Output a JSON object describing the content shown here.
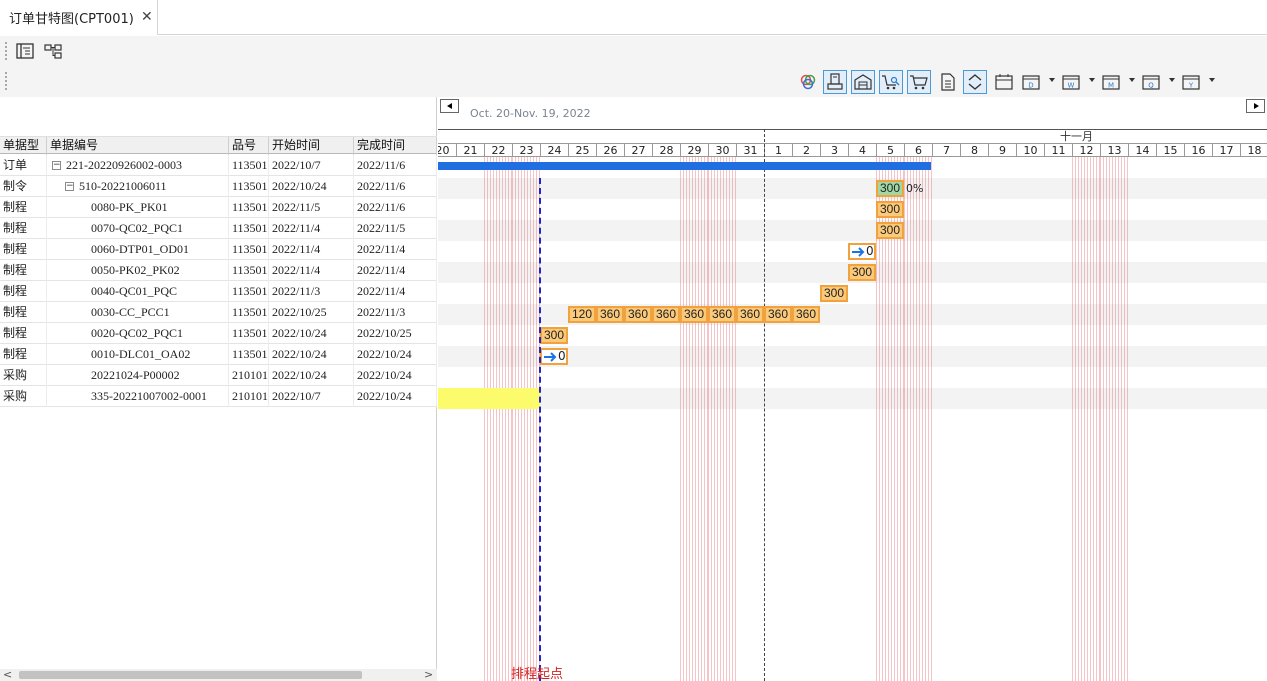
{
  "tab": {
    "title": "订单甘特图(CPT001)",
    "close_icon": "✕"
  },
  "toolbar1": {
    "buttons": [
      "list-view-icon",
      "tree-view-icon"
    ]
  },
  "toolbar2": {
    "buttons": [
      "color-circles-icon",
      "save-icon",
      "warehouse-icon",
      "cart-search-icon",
      "cart-icon",
      "document-icon",
      "expand-collapse-icon",
      "calendar-icon",
      "calendar-day-icon",
      "calendar-week-icon",
      "calendar-month-icon",
      "calendar-quarter-icon",
      "calendar-year-icon"
    ],
    "calendar_letters": {
      "day": "D",
      "week": "W",
      "month": "M",
      "quarter": "Q",
      "year": "Y"
    }
  },
  "grid": {
    "columns": [
      "单据型",
      "单据编号",
      "品号",
      "开始时间",
      "完成时间"
    ],
    "expander_symbol": "−",
    "rows": [
      {
        "type": "订单",
        "code": "221-20220926002-0003",
        "part": "113501",
        "start": "2022/10/7",
        "end": "2022/11/6",
        "expander": true,
        "indent": 0
      },
      {
        "type": "制令",
        "code": "510-20221006011",
        "part": "113501",
        "start": "2022/10/24",
        "end": "2022/11/6",
        "expander": true,
        "indent": 1
      },
      {
        "type": "制程",
        "code": "0080-PK_PK01",
        "part": "113501",
        "start": "2022/11/5",
        "end": "2022/11/6",
        "expander": false,
        "indent": 2
      },
      {
        "type": "制程",
        "code": "0070-QC02_PQC1",
        "part": "113501",
        "start": "2022/11/4",
        "end": "2022/11/5",
        "expander": false,
        "indent": 2
      },
      {
        "type": "制程",
        "code": "0060-DTP01_OD01",
        "part": "113501",
        "start": "2022/11/4",
        "end": "2022/11/4",
        "expander": false,
        "indent": 2
      },
      {
        "type": "制程",
        "code": "0050-PK02_PK02",
        "part": "113501",
        "start": "2022/11/4",
        "end": "2022/11/4",
        "expander": false,
        "indent": 2
      },
      {
        "type": "制程",
        "code": "0040-QC01_PQC",
        "part": "113501",
        "start": "2022/11/3",
        "end": "2022/11/4",
        "expander": false,
        "indent": 2
      },
      {
        "type": "制程",
        "code": "0030-CC_PCC1",
        "part": "113501",
        "start": "2022/10/25",
        "end": "2022/11/3",
        "expander": false,
        "indent": 2
      },
      {
        "type": "制程",
        "code": "0020-QC02_PQC1",
        "part": "113501",
        "start": "2022/10/24",
        "end": "2022/10/25",
        "expander": false,
        "indent": 2
      },
      {
        "type": "制程",
        "code": "0010-DLC01_OA02",
        "part": "113501",
        "start": "2022/10/24",
        "end": "2022/10/24",
        "expander": false,
        "indent": 2
      },
      {
        "type": "采购",
        "code": "20221024-P00002",
        "part": "210101",
        "start": "2022/10/24",
        "end": "2022/10/24",
        "expander": false,
        "indent": 2
      },
      {
        "type": "采购",
        "code": "335-20221007002-0001",
        "part": "210101",
        "start": "2022/10/7",
        "end": "2022/10/24",
        "expander": false,
        "indent": 2
      }
    ],
    "scroll_left": "<",
    "scroll_right": ">"
  },
  "gantt": {
    "range_label": "Oct. 20-Nov. 19, 2022",
    "month_label": "十一月",
    "days": [
      "20",
      "21",
      "22",
      "23",
      "24",
      "25",
      "26",
      "27",
      "28",
      "29",
      "30",
      "31",
      "1",
      "2",
      "3",
      "4",
      "5",
      "6",
      "7",
      "8",
      "9",
      "10",
      "11",
      "12",
      "13",
      "14",
      "15",
      "16",
      "17",
      "18",
      "19"
    ],
    "weekend_day_indices": [
      2,
      3,
      9,
      10,
      16,
      17,
      23,
      24,
      30
    ],
    "schedule_start_day_index": 4,
    "month_divider_day_index": 12,
    "order_bar": {
      "start_day_index": 0,
      "end_day_index": 17
    },
    "order_progress": "0%",
    "tasks": [
      {
        "row": 1,
        "cells": [
          {
            "day": 16,
            "value": "300",
            "style": "green"
          }
        ]
      },
      {
        "row": 2,
        "cells": [
          {
            "day": 16,
            "value": "300",
            "style": "orange"
          }
        ]
      },
      {
        "row": 3,
        "cells": [
          {
            "day": 16,
            "value": "300",
            "style": "orange"
          }
        ]
      },
      {
        "row": 4,
        "cells": [
          {
            "day": 15,
            "value": "0",
            "style": "arrow"
          }
        ]
      },
      {
        "row": 5,
        "cells": [
          {
            "day": 15,
            "value": "300",
            "style": "orange"
          }
        ]
      },
      {
        "row": 6,
        "cells": [
          {
            "day": 14,
            "value": "300",
            "style": "orange"
          }
        ]
      },
      {
        "row": 7,
        "cells": [
          {
            "day": 5,
            "value": "120",
            "style": "orange"
          },
          {
            "day": 6,
            "value": "360",
            "style": "orange"
          },
          {
            "day": 7,
            "value": "360",
            "style": "orange"
          },
          {
            "day": 8,
            "value": "360",
            "style": "orange"
          },
          {
            "day": 9,
            "value": "360",
            "style": "orange"
          },
          {
            "day": 10,
            "value": "360",
            "style": "orange"
          },
          {
            "day": 11,
            "value": "360",
            "style": "orange"
          },
          {
            "day": 12,
            "value": "360",
            "style": "orange"
          },
          {
            "day": 13,
            "value": "360",
            "style": "orange"
          }
        ]
      },
      {
        "row": 8,
        "cells": [
          {
            "day": 4,
            "value": "300",
            "style": "orange"
          }
        ]
      },
      {
        "row": 9,
        "cells": [
          {
            "day": 4,
            "value": "0",
            "style": "arrow"
          }
        ]
      }
    ],
    "purchase_bar": {
      "row": 11,
      "start_day_index": 0,
      "end_day_index": 3
    },
    "schedule_start_label": "排程起点",
    "colors": {
      "task_fill": "#fbc97a",
      "task_border": "#f2a23d",
      "done_fill": "#9fd8a4",
      "order_bar": "#1f6fe0",
      "purchase_bar": "#fbfb6c",
      "start_line": "#2323c8",
      "start_label": "#d42020"
    }
  }
}
